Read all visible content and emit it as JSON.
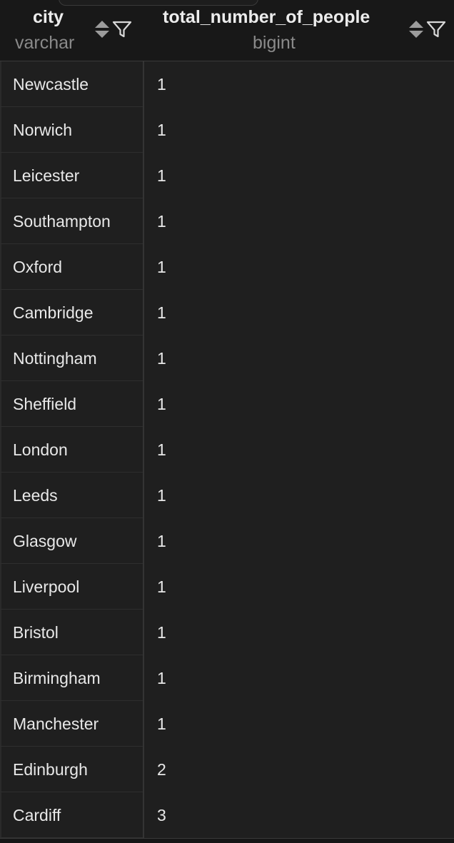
{
  "columns": [
    {
      "name": "city",
      "type": "varchar",
      "sort_icon": "sort-updown-icon",
      "filter_icon": "filter-funnel-icon"
    },
    {
      "name": "total_number_of_people",
      "type": "bigint",
      "sort_icon": "sort-updown-icon",
      "filter_icon": "filter-funnel-icon"
    }
  ],
  "rows": [
    {
      "city": "Newcastle",
      "count": "1"
    },
    {
      "city": "Norwich",
      "count": "1"
    },
    {
      "city": "Leicester",
      "count": "1"
    },
    {
      "city": "Southampton",
      "count": "1"
    },
    {
      "city": "Oxford",
      "count": "1"
    },
    {
      "city": "Cambridge",
      "count": "1"
    },
    {
      "city": "Nottingham",
      "count": "1"
    },
    {
      "city": "Sheffield",
      "count": "1"
    },
    {
      "city": "London",
      "count": "1"
    },
    {
      "city": "Leeds",
      "count": "1"
    },
    {
      "city": "Glasgow",
      "count": "1"
    },
    {
      "city": "Liverpool",
      "count": "1"
    },
    {
      "city": "Bristol",
      "count": "1"
    },
    {
      "city": "Birmingham",
      "count": "1"
    },
    {
      "city": "Manchester",
      "count": "1"
    },
    {
      "city": "Edinburgh",
      "count": "2"
    },
    {
      "city": "Cardiff",
      "count": "3"
    }
  ],
  "colors": {
    "background": "#1f1f1f",
    "header": "#181818",
    "text": "#e8e8e8",
    "muted": "#8a8a8a"
  }
}
